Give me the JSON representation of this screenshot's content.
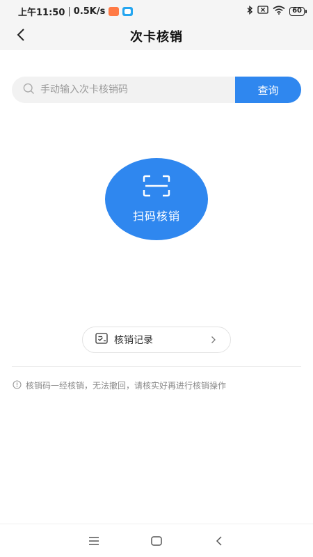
{
  "status_bar": {
    "time": "上午11:50",
    "separator": "|",
    "network_speed": "0.5K/s",
    "battery": "60",
    "icons": [
      "orange-notification-icon",
      "blue-notification-icon",
      "bluetooth-icon",
      "no-sim-icon",
      "wifi-icon",
      "battery-icon"
    ]
  },
  "nav": {
    "title": "次卡核销",
    "back_icon": "back-arrow-icon"
  },
  "search": {
    "placeholder": "手动输入次卡核销码",
    "value": "",
    "button_label": "查询",
    "icon": "search-icon"
  },
  "scan": {
    "label": "扫码核销",
    "icon": "scan-frame-icon"
  },
  "records": {
    "label": "核销记录",
    "icon": "record-list-icon",
    "chevron_icon": "chevron-right-icon"
  },
  "notice": {
    "text": "核销码一经核销，无法撤回，请核实好再进行核销操作",
    "icon": "info-icon"
  },
  "system_nav": {
    "icons": [
      "menu-icon",
      "home-icon",
      "back-icon"
    ]
  },
  "colors": {
    "accent": "#2f87ef",
    "status_bar_bg": "#f5f5f5",
    "search_bg": "#f2f2f2",
    "notice_text": "#8a8a8a"
  }
}
